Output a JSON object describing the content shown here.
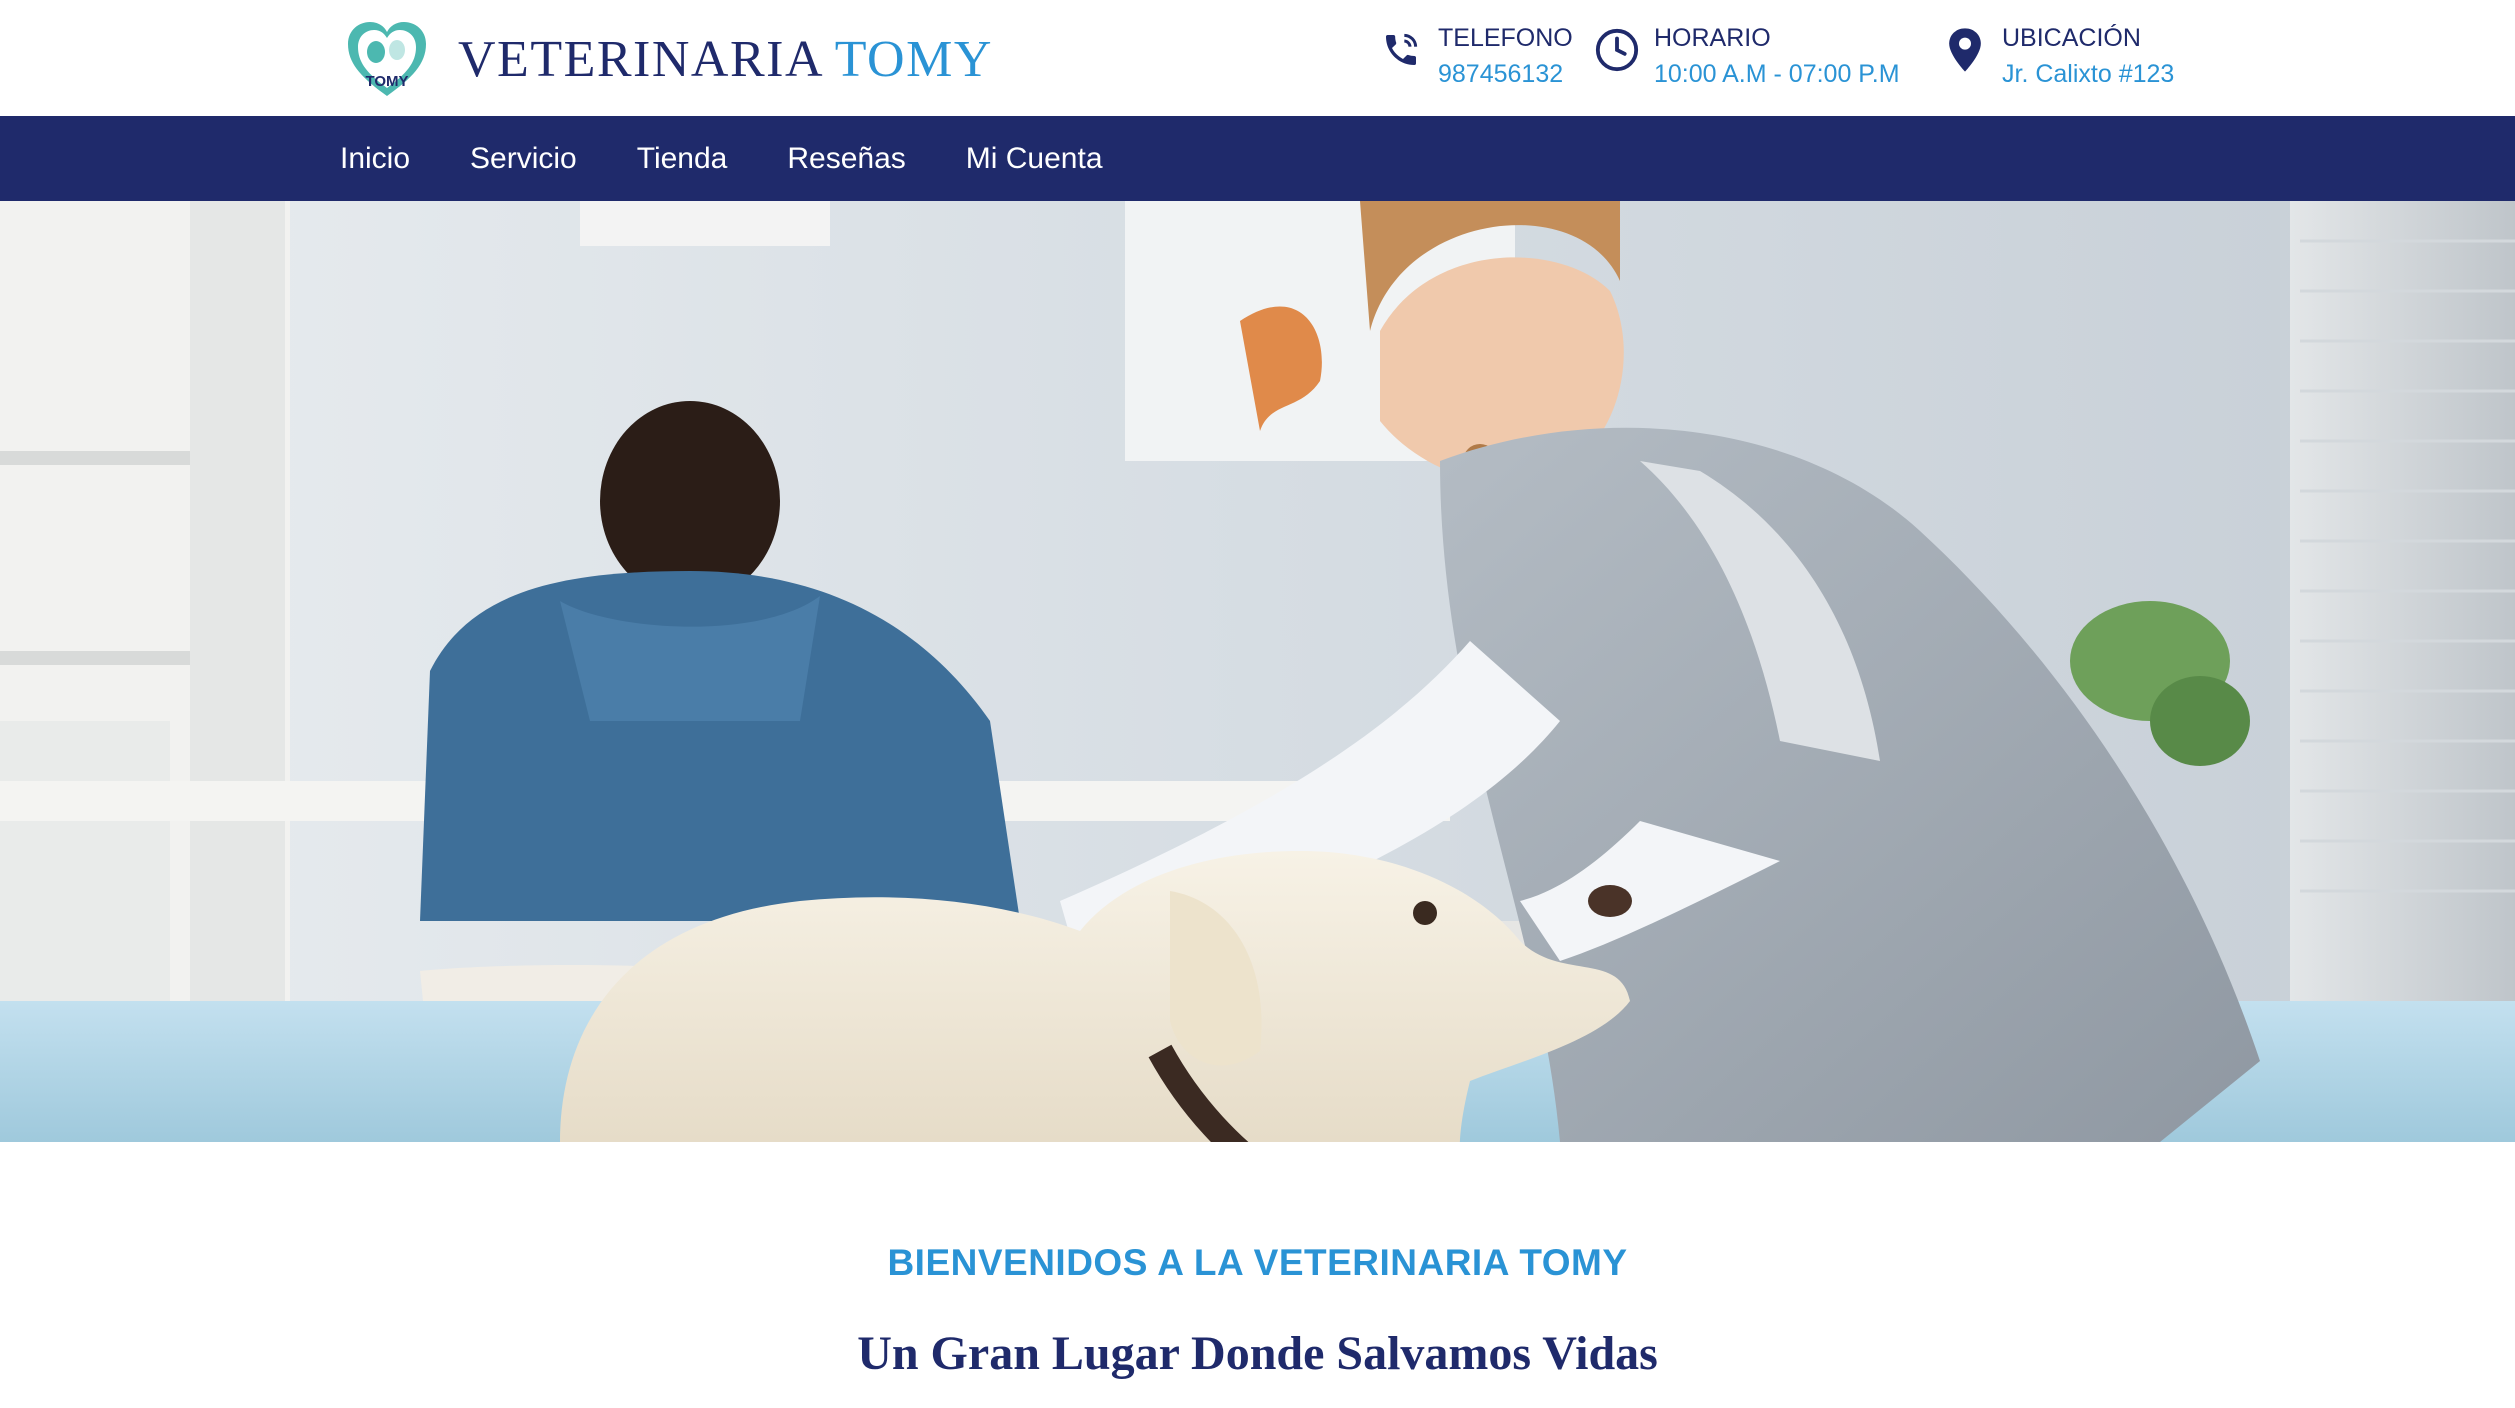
{
  "brand": {
    "name_main": "VETERINARIA",
    "name_accent": "TOMY",
    "logo_text": "TOMY",
    "logo_icon": "heart-paw-logo"
  },
  "contact": {
    "phone": {
      "title": "TELEFONO",
      "value": "987456132",
      "icon": "phone-icon"
    },
    "hours": {
      "title": "HORARIO",
      "value": "10:00 A.M - 07:00 P.M",
      "icon": "clock-icon"
    },
    "location": {
      "title": "UBICACIÓN",
      "value": "Jr. Calixto #123",
      "icon": "map-pin-icon"
    }
  },
  "nav": {
    "items": [
      {
        "label": "Inicio"
      },
      {
        "label": "Servicio"
      },
      {
        "label": "Tienda"
      },
      {
        "label": "Reseñas"
      },
      {
        "label": "Mi Cuenta"
      }
    ]
  },
  "hero": {
    "image": "veterinarian-vaccinating-dog-photo"
  },
  "welcome": {
    "kicker": "BIENVENIDOS A LA VETERINARIA TOMY",
    "title": "Un Gran Lugar Donde Salvamos Vidas"
  },
  "colors": {
    "navy": "#1f2a6b",
    "accent_blue": "#2a93d5",
    "logo_teal": "#4cb8b0"
  }
}
